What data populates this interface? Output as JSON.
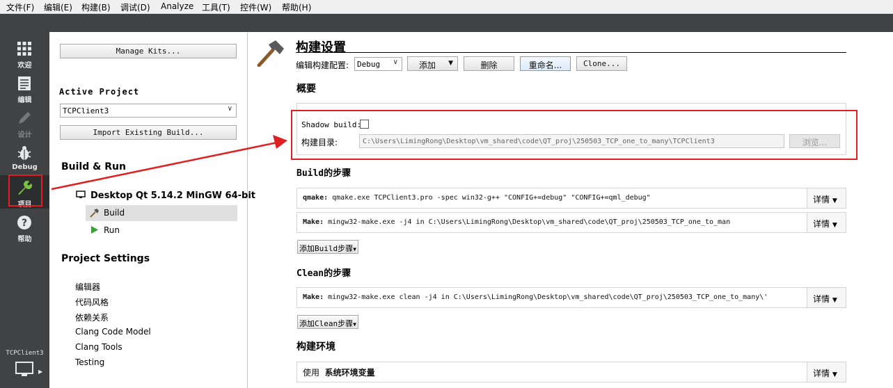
{
  "menu": [
    "文件(F)",
    "编辑(E)",
    "构建(B)",
    "调试(D)",
    "Analyze",
    "工具(T)",
    "控件(W)",
    "帮助(H)"
  ],
  "modes": [
    {
      "label": "欢迎",
      "icon": "grid-icon"
    },
    {
      "label": "编辑",
      "icon": "document-icon"
    },
    {
      "label": "设计",
      "icon": "pencil-icon"
    },
    {
      "label": "Debug",
      "icon": "bug-icon"
    },
    {
      "label": "项目",
      "icon": "wrench-icon"
    },
    {
      "label": "帮助",
      "icon": "help-icon"
    }
  ],
  "kit_selector": {
    "project": "TCPClient3"
  },
  "left": {
    "manage_kits": "Manage Kits...",
    "active_project_label": "Active Project",
    "active_project_value": "TCPClient3",
    "import_build": "Import Existing Build...",
    "build_run_heading": "Build & Run",
    "kit_name": "Desktop Qt 5.14.2 MinGW 64-bit",
    "build_item": "Build",
    "run_item": "Run",
    "project_settings_heading": "Project Settings",
    "settings_items": [
      "编辑器",
      "代码风格",
      "依赖关系",
      "Clang Code Model",
      "Clang Tools",
      "Testing"
    ]
  },
  "right": {
    "title": "构建设置",
    "edit_config_label": "编辑构建配置:",
    "config_value": "Debug",
    "add_btn": "添加",
    "delete_btn": "删除",
    "rename_btn": "重命名...",
    "clone_btn": "Clone...",
    "overview_heading": "概要",
    "shadow_build_label": "Shadow build:",
    "build_dir_label": "构建目录:",
    "build_dir_value": "C:\\Users\\LimingRong\\Desktop\\vm_shared\\code\\QT_proj\\250503_TCP_one_to_many\\TCPClient3",
    "browse_btn": "浏览...",
    "build_steps_heading": "Build的步骤",
    "qmake_prefix": "qmake:",
    "qmake_cmd": " qmake.exe TCPClient3.pro -spec win32-g++ \"CONFIG+=debug\" \"CONFIG+=qml_debug\"",
    "make_prefix": "Make:",
    "make_cmd": " mingw32-make.exe -j4 in C:\\Users\\LimingRong\\Desktop\\vm_shared\\code\\QT_proj\\250503_TCP_one_to_man",
    "add_build_step": "添加Build步骤",
    "clean_steps_heading": "Clean的步骤",
    "clean_make_cmd": " mingw32-make.exe clean -j4 in C:\\Users\\LimingRong\\Desktop\\vm_shared\\code\\QT_proj\\250503_TCP_one_to_many\\'",
    "add_clean_step": "添加Clean步骤",
    "build_env_heading": "构建环境",
    "env_use": "使用",
    "env_value": "系统环境变量",
    "details": "详情"
  },
  "colors": {
    "annotation": "#e02020",
    "modebar": "#404244",
    "run_green": "#2fa82f"
  }
}
